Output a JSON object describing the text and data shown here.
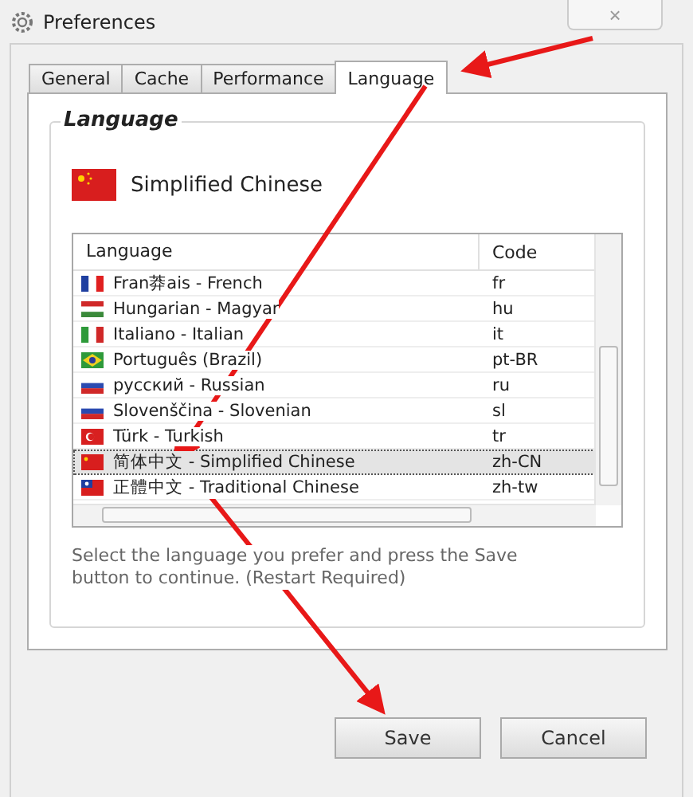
{
  "window": {
    "title": "Preferences",
    "close": "×"
  },
  "tabs": [
    {
      "label": "General",
      "selected": false
    },
    {
      "label": "Cache",
      "selected": false
    },
    {
      "label": "Performance",
      "selected": false
    },
    {
      "label": "Language",
      "selected": true
    }
  ],
  "group": {
    "title": "Language",
    "current_language": "Simplified Chinese"
  },
  "table": {
    "columns": [
      "Language",
      "Code"
    ],
    "rows": [
      {
        "language": "Fran莽ais - French",
        "code": "fr",
        "selected": false
      },
      {
        "language": "Hungarian - Magyar",
        "code": "hu",
        "selected": false
      },
      {
        "language": "Italiano - Italian",
        "code": "it",
        "selected": false
      },
      {
        "language": "Português (Brazil)",
        "code": "pt-BR",
        "selected": false
      },
      {
        "language": "русский - Russian",
        "code": "ru",
        "selected": false
      },
      {
        "language": "Slovenščina - Slovenian",
        "code": "sl",
        "selected": false
      },
      {
        "language": "Türk - Turkish",
        "code": "tr",
        "selected": false
      },
      {
        "language": "简体中文 - Simplified Chinese",
        "code": "zh-CN",
        "selected": true
      },
      {
        "language": "正體中文 - Traditional Chinese",
        "code": "zh-tw",
        "selected": false
      }
    ]
  },
  "hint": "Select the language you prefer and press the Save button to continue. (Restart Required)",
  "buttons": [
    "Save",
    "Cancel"
  ]
}
